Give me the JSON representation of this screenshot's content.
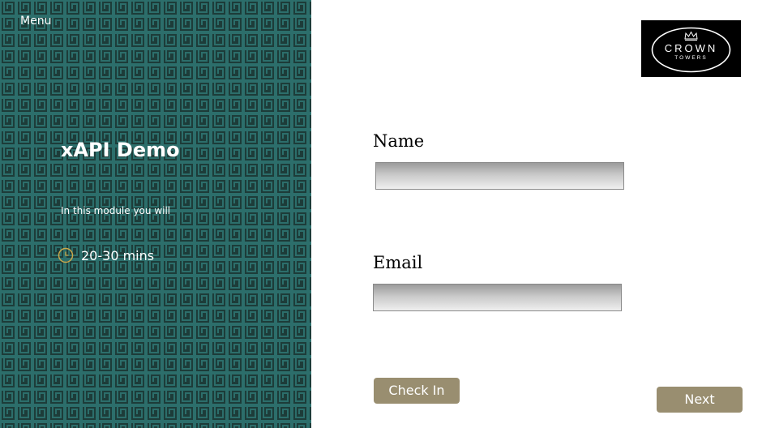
{
  "nav": {
    "menu_label": "Menu"
  },
  "module": {
    "title": "xAPI Demo",
    "intro": "In this module you will",
    "duration": "20-30 mins",
    "clock_icon": "clock-icon"
  },
  "brand": {
    "logo_line1": "CROWN",
    "logo_line2": "TOWERS",
    "crown_icon": "crown-icon"
  },
  "form": {
    "name_label": "Name",
    "name_value": "",
    "email_label": "Email",
    "email_value": ""
  },
  "buttons": {
    "check_in": "Check In",
    "next": "Next"
  },
  "colors": {
    "panel_bg": "#1d3c39",
    "pattern_line": "#2c6e6b",
    "button_bg": "#998e70",
    "clock_color": "#c9a84c",
    "field_border": "#8a8a8a"
  }
}
